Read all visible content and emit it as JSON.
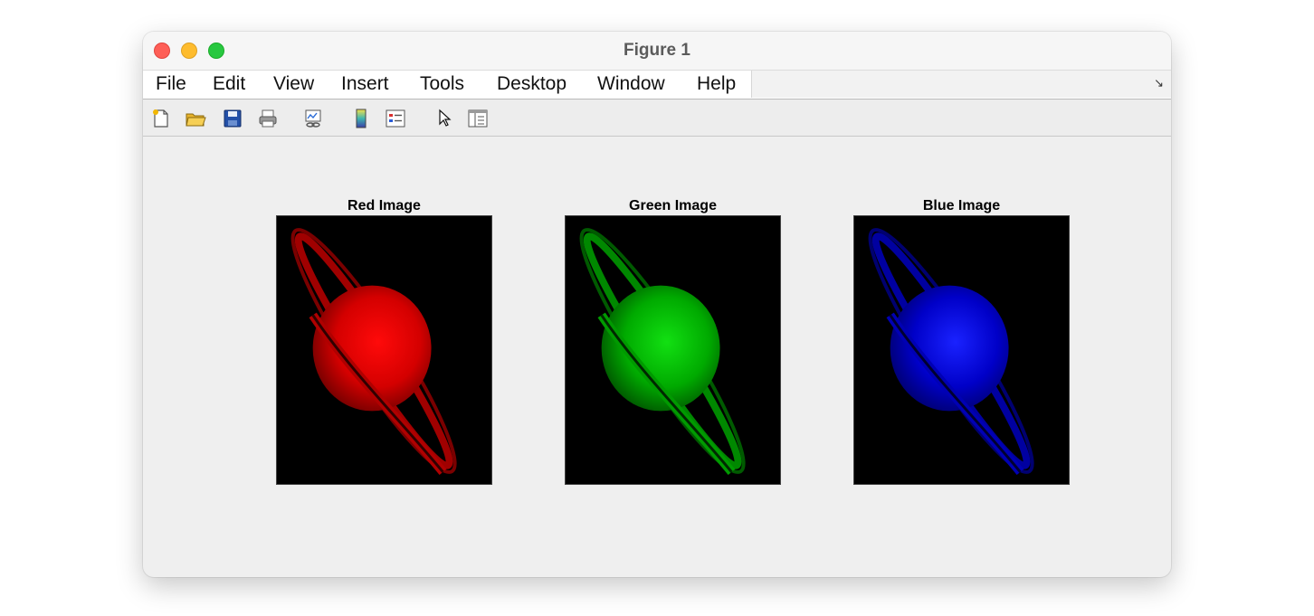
{
  "window": {
    "title": "Figure 1"
  },
  "menu": {
    "items": [
      "File",
      "Edit",
      "View",
      "Insert",
      "Tools",
      "Desktop",
      "Window",
      "Help"
    ],
    "overflow_icon": "arrow-icon"
  },
  "toolbar": {
    "tools": [
      "new-figure-icon",
      "open-file-icon",
      "save-icon",
      "print-icon",
      "link-plot-icon",
      "colorbar-icon",
      "legend-icon",
      "pointer-icon",
      "property-editor-icon"
    ]
  },
  "panels": [
    {
      "title": "Red Image",
      "color": "#e30000"
    },
    {
      "title": "Green Image",
      "color": "#00c800"
    },
    {
      "title": "Blue Image",
      "color": "#0010e6"
    }
  ]
}
